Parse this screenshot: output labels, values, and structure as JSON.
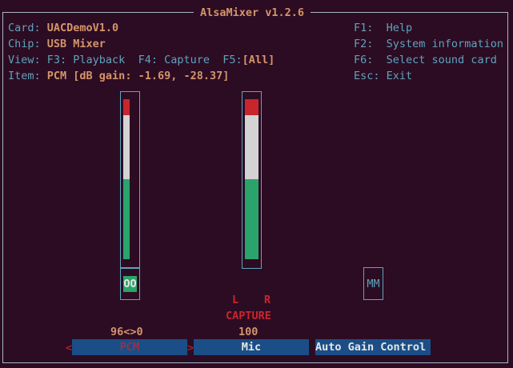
{
  "title": "AlsaMixer v1.2.6",
  "info": {
    "card_label": "Card:",
    "card_value": "UACDemoV1.0",
    "chip_label": "Chip:",
    "chip_value": "USB Mixer",
    "view_label": "View:",
    "view_f3": "F3: Playback",
    "view_f4": "F4: Capture",
    "view_f5_key": "F5:",
    "view_f5_value": "[All]",
    "item_label": "Item:",
    "item_value": "PCM [dB gain: -1.69, -28.37]"
  },
  "help": [
    {
      "key": "F1:",
      "text": "Help"
    },
    {
      "key": "F2:",
      "text": "System information"
    },
    {
      "key": "F6:",
      "text": "Select sound card"
    },
    {
      "key": "Esc:",
      "text": "Exit"
    }
  ],
  "controls": {
    "pcm": {
      "switch": "OO",
      "value": "96<>0",
      "label": "PCM",
      "arrow_left": "<",
      "arrow_right": ">",
      "level_left": 0.96,
      "level_right": 0
    },
    "mic": {
      "channel_left": "L",
      "channel_right": "R",
      "capture": "CAPTURE",
      "value": "100",
      "label": "Mic",
      "level": 1.0
    },
    "agc": {
      "switch": "MM",
      "label": "Auto Gain Control"
    }
  },
  "colors": {
    "background": "#2c0c23",
    "accent": "#d4956a",
    "label": "#5fa3bd",
    "selected": "#1b4e86",
    "red": "#c8262d",
    "green": "#2aa46a"
  }
}
